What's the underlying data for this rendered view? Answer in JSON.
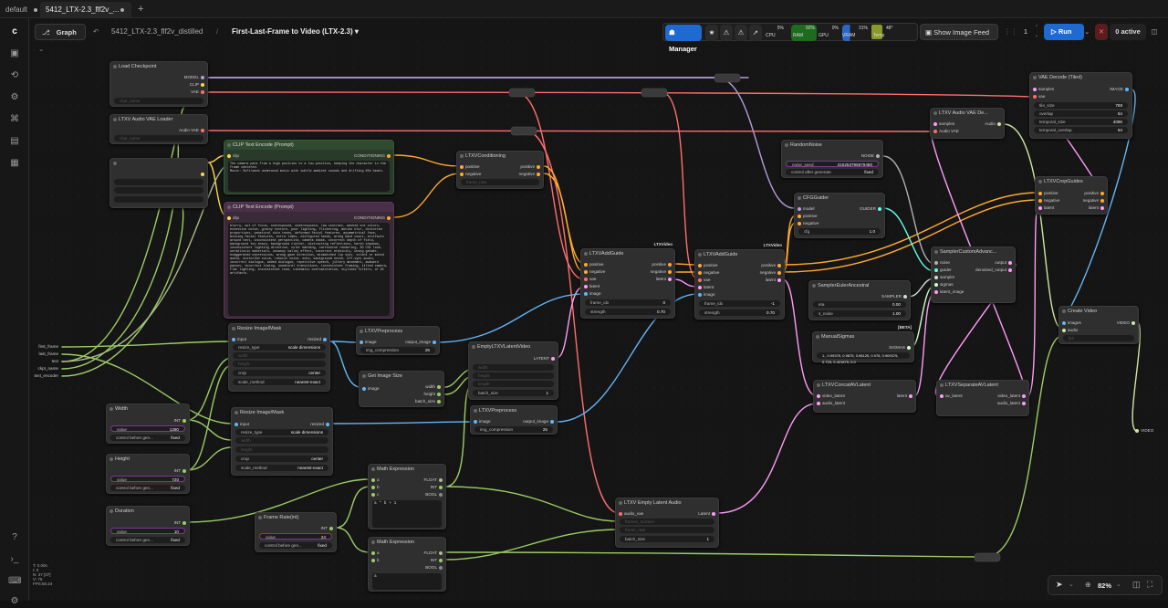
{
  "tabs": [
    {
      "label": "default"
    },
    {
      "label": "5412_LTX-2.3_flf2v_..."
    }
  ],
  "toolbar": {
    "graph_label": "Graph",
    "workflow_name": "5412_LTX-2.3_flf2v_distilled",
    "subgraph_name": "First-Last-Frame to Video (LTX-2.3)",
    "manager_label": "Manager",
    "cpu_label": "CPU",
    "cpu_value": "5%",
    "ram_label": "RAM",
    "ram_value": "92%",
    "gpu_label": "GPU",
    "gpu_value": "0%",
    "vram_label": "VRAM",
    "vram_value": "31%",
    "temp_label": "Temp",
    "temp_value": "48°",
    "image_feed_label": "Show Image Feed",
    "queue_count": "1",
    "run_label": "Run",
    "active_label": "0 active"
  },
  "sidebar": {
    "icons": [
      "logo-icon",
      "images-icon",
      "models-icon",
      "nodes-icon",
      "workflows-icon",
      "templates-icon",
      "library-icon",
      "help-icon",
      "terminal-icon",
      "keyboard-icon",
      "settings-icon"
    ]
  },
  "stats": {
    "line1": "T: 0.00s",
    "line2": "I: 0",
    "line3": "N: 37 [37]",
    "line4": "V: 75",
    "line5": "FPS:60.24"
  },
  "zoom": {
    "value": "82%"
  },
  "nodes": {
    "load_checkpoint": {
      "title": "Load Checkpoint",
      "out1": "MODEL",
      "out2": "CLIP",
      "out3": "VAE",
      "w1": "ckpt_name"
    },
    "audio_vae": {
      "title": "LTXV Audio VAE Loader",
      "out1": "Audio VAE",
      "w1": "ckpt_name"
    },
    "text_encoder": "text_encoder",
    "clip_pos": {
      "title": "CLIP Text Encode (Prompt)",
      "in1": "clip",
      "out1": "CONDITIONING",
      "text": "The camera pans from a high position to a low position, keeping the character in the frame centered.\nMusic: Soft/warm underwood music with subtle ambient sounds and drifting 80s beats."
    },
    "clip_neg": {
      "title": "CLIP Text Encode (Prompt)",
      "in1": "clip",
      "out1": "CONDITIONING",
      "text": "blurry, out of focus, overexposed, underexposed, low contrast, washed out colors, excessive noise, grainy texture, poor lighting, flickering, motion blur, distorted proportions, unnatural skin tones, deformed facial features, asymmetrical face, missing facial features, extra limbs, disfigured hands, wrong hand count, artifacts around text, inconsistent perspective, camera shake, incorrect depth of field, background too sharp, background clutter, distracting reflections, harsh shadows, inconsistent lighting direction, color banding, cartoonish rendering, 3D CGI look, unrealistic materials, uncanny valley effect, incorrect ethnicity, wrong gender, exaggerated expressions, wrong gaze direction, mismatched lip sync, silent or muted audio, distorted voice, robotic voice, echo, background noise, off-sync audio, incorrect dialogue, added dialogue, repetitive speech, jittery movement, awkward pauses, incorrect timing, unnatural transitions, inconsistent framing, tilted camera, flat lighting, inconsistent tone, cinematic oversaturation, stylized filters, or AI artifacts."
    },
    "conditioning": {
      "title": "LTXVConditioning",
      "in1": "positive",
      "in2": "negative",
      "out1": "positive",
      "out2": "negative",
      "w1": "frame_rate"
    },
    "first_frame": "first_frame",
    "last_frame": "last_frame",
    "text": "text",
    "ckpt_name": "ckpt_name",
    "resize1": {
      "title": "Resize Image/Mask",
      "in1": "input",
      "out1": "resized",
      "w1l": "resize_type",
      "w1v": "scale dimensions",
      "w2": "width",
      "w3": "height",
      "w4l": "crop",
      "w4v": "center",
      "w5l": "scale_method",
      "w5v": "nearest-exact"
    },
    "resize2": {
      "title": "Resize Image/Mask",
      "in1": "input",
      "out1": "resized",
      "w1l": "resize_type",
      "w1v": "scale dimensions",
      "w2": "width",
      "w3": "height",
      "w4l": "crop",
      "w4v": "center",
      "w5l": "scale_method",
      "w5v": "nearest-exact"
    },
    "preprocess1": {
      "title": "LTXVPreprocess",
      "in1": "image",
      "out1": "output_image",
      "w1l": "img_compression",
      "w1v": "25"
    },
    "preprocess2": {
      "title": "LTXVPreprocess",
      "in1": "image",
      "out1": "output_image",
      "w1l": "img_compression",
      "w1v": "25"
    },
    "get_size": {
      "title": "Get Image Size",
      "in1": "image",
      "out1": "width",
      "out2": "height",
      "out3": "batch_size"
    },
    "empty_latent": {
      "title": "EmptyLTXVLatentVideo",
      "out1": "LATENT",
      "w1": "width",
      "w2": "height",
      "w3": "length",
      "w4l": "batch_size",
      "w4v": "1"
    },
    "width": {
      "title": "Width",
      "out1": "INT",
      "w1l": "value",
      "w1v": "1280",
      "w2l": "control before gen...",
      "w2v": "fixed"
    },
    "height": {
      "title": "Height",
      "out1": "INT",
      "w1l": "value",
      "w1v": "720",
      "w2l": "control before gen...",
      "w2v": "fixed"
    },
    "duration": {
      "title": "Duration",
      "out1": "INT",
      "w1l": "value",
      "w1v": "10",
      "w2l": "control before gen...",
      "w2v": "fixed"
    },
    "frame_rate": {
      "title": "Frame Rate(int)",
      "out1": "INT",
      "w1l": "value",
      "w1v": "24",
      "w2l": "control before gen...",
      "w2v": "fixed"
    },
    "math1": {
      "title": "Math Expression",
      "in1": "a",
      "in2": "b",
      "in3": "c",
      "out1": "FLOAT",
      "out2": "INT",
      "out3": "BOOL",
      "expr": "a * b + 1"
    },
    "math2": {
      "title": "Math Expression",
      "in1": "a",
      "in2": "b",
      "out1": "FLOAT",
      "out2": "INT",
      "out3": "BOOL",
      "expr": "a"
    },
    "addguide1": {
      "title": "LTXVAddGuide",
      "badge": "LTXVideo",
      "in1": "positive",
      "in2": "negative",
      "in3": "vae",
      "in4": "latent",
      "in5": "image",
      "out1": "positive",
      "out2": "negative",
      "out3": "latent",
      "w1l": "frame_idx",
      "w1v": "0",
      "w2l": "strength",
      "w2v": "0.70"
    },
    "addguide2": {
      "title": "LTXVAddGuide",
      "badge": "LTXVideo",
      "in1": "positive",
      "in2": "negative",
      "in3": "vae",
      "in4": "latent",
      "in5": "image",
      "out1": "positive",
      "out2": "negative",
      "out3": "latent",
      "w1l": "frame_idx",
      "w1v": "-1",
      "w2l": "strength",
      "w2v": "0.70"
    },
    "empty_audio": {
      "title": "LTXV Empty Latent Audio",
      "in1": "audio_vae",
      "out1": "Latent",
      "w1": "frames_number",
      "w2": "frame_rate",
      "w3l": "batch_size",
      "w3v": "1"
    },
    "random_noise": {
      "title": "RandomNoise",
      "out1": "NOISE",
      "w1l": "noise_seed",
      "w1v": "315253795979480",
      "w2l": "control after generate",
      "w2v": "fixed"
    },
    "cfg_guider": {
      "title": "CFGGuider",
      "in1": "model",
      "in2": "positive",
      "in3": "negative",
      "out1": "GUIDER",
      "w1l": "cfg",
      "w1v": "1.0"
    },
    "sampler_euler": {
      "title": "SamplerEulerAncestral",
      "out1": "SAMPLER",
      "w1l": "eta",
      "w1v": "0.00",
      "w2l": "s_noise",
      "w2v": "1.00"
    },
    "manual_sigmas": {
      "title": "ManualSigmas",
      "badge": "BETA",
      "out1": "SIGMAS",
      "w1": "1., 0.99375, 0.9875, 0.98125, 0.975, 0.909375, 0.725, 0.421875, 0.0"
    },
    "concat": {
      "title": "LTXVConcatAVLatent",
      "in1": "video_latent",
      "in2": "audio_latent",
      "out1": "latent"
    },
    "sampler_custom": {
      "title": "SamplerCustomAdvanc...",
      "in1": "noise",
      "in2": "guider",
      "in3": "sampler",
      "in4": "sigmas",
      "in5": "latent_image",
      "out1": "output",
      "out2": "denoised_output"
    },
    "separate": {
      "title": "LTXVSeparateAVLatent",
      "in1": "av_latent",
      "out1": "video_latent",
      "out2": "audio_latent"
    },
    "audio_vae_decode": {
      "title": "LTXV Audio VAE De...",
      "in1": "samples",
      "in2": "Audio VAE",
      "out1": "Audio"
    },
    "vae_decode_tiled": {
      "title": "VAE Decode (Tiled)",
      "in1": "samples",
      "in2": "vae",
      "out1": "IMAGE",
      "w1l": "tile_size",
      "w1v": "768",
      "w2l": "overlap",
      "w2v": "64",
      "w3l": "temporal_size",
      "w3v": "4096",
      "w4l": "temporal_overlap",
      "w4v": "64"
    },
    "crop_guides": {
      "title": "LTXVCropGuides",
      "in1": "positive",
      "in2": "negative",
      "in3": "latent",
      "out1": "positive",
      "out2": "negative",
      "out3": "latent"
    },
    "create_video": {
      "title": "Create Video",
      "in1": "images",
      "in2": "audio",
      "out1": "VIDEO",
      "w1": "fps"
    },
    "video_out": "VIDEO"
  },
  "colors": {
    "model": "#b39ddb",
    "clip": "#ffd54f",
    "vae": "#ff6e6e",
    "conditioning": "#ffa931",
    "latent": "#ff9cf9",
    "image": "#64b5f6",
    "int": "#9ccc65",
    "float": "#aabb88",
    "audio": "#cfe6a0",
    "noise": "#b0b0b0",
    "guider": "#66ffee",
    "sigmas": "#cdffcd"
  }
}
